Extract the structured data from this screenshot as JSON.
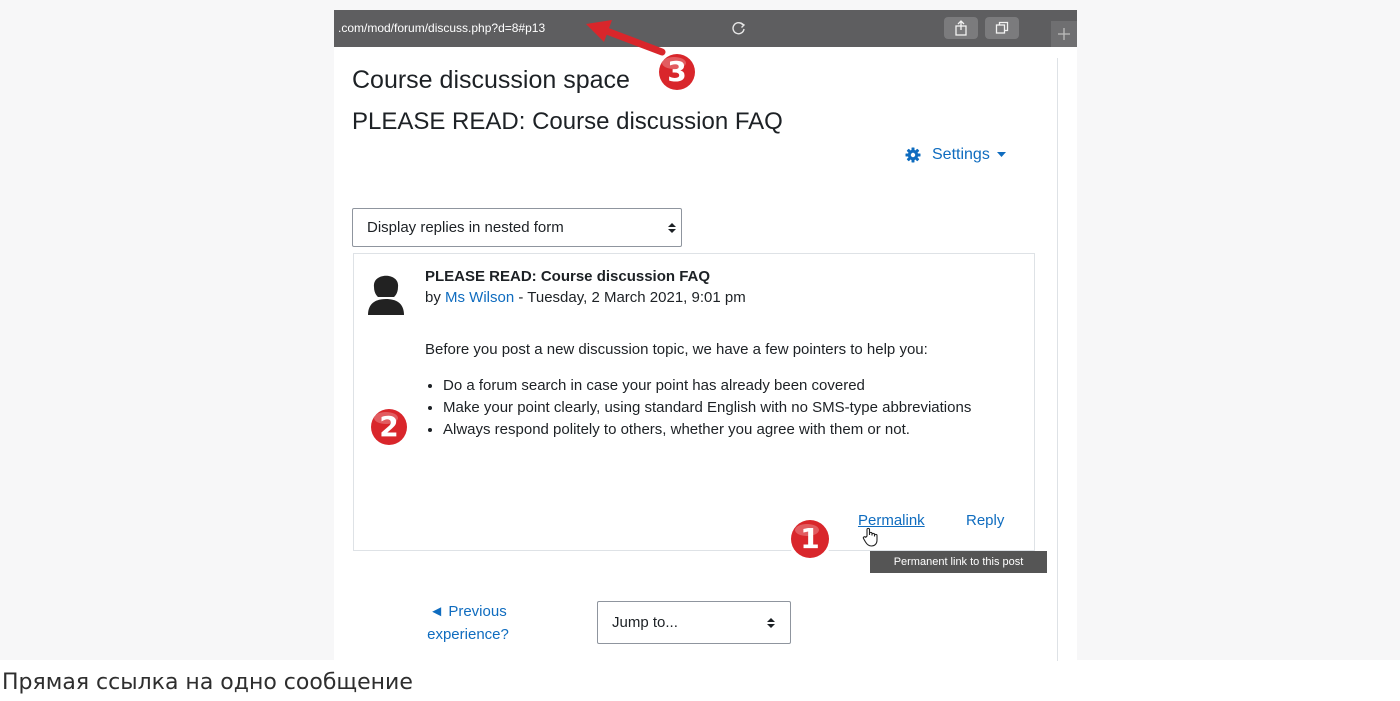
{
  "browser": {
    "url": ".com/mod/forum/discuss.php?d=8#p13"
  },
  "course": {
    "title": "Course discussion space"
  },
  "discussion": {
    "title": "PLEASE READ: Course discussion FAQ"
  },
  "settings_menu": {
    "label": "Settings"
  },
  "display_mode": {
    "selected": "Display replies in nested form"
  },
  "post": {
    "subject": "PLEASE READ: Course discussion FAQ",
    "by_prefix": "by ",
    "author": "Ms Wilson",
    "date": " - Tuesday, 2 March 2021, 9:01 pm",
    "intro": "Before you post a new discussion topic, we have a few pointers to help you:",
    "bullets": [
      "Do a forum search in case your point has already been covered",
      "Make your point clearly, using standard English with no SMS-type abbreviations",
      "Always respond politely to others, whether you agree with them or not."
    ],
    "permalink_label": "Permalink",
    "reply_label": "Reply"
  },
  "tooltip": {
    "text": "Permanent link to this post"
  },
  "navigation": {
    "previous_arrow": "◄",
    "previous_label": "Previous",
    "previous_label_2": "experience?",
    "jump_to": "Jump to..."
  },
  "annotations": {
    "badge_1": "1",
    "badge_2": "2",
    "badge_3": "3"
  },
  "caption": "Прямая ссылка на одно сообщение",
  "colors": {
    "link": "#0f6cbf",
    "badge_red": "#d9262b",
    "address_bar": "#5e5e60"
  }
}
